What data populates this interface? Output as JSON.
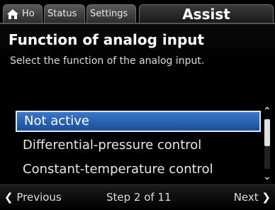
{
  "tabs": {
    "home_label": "Ho",
    "status_label": "Status",
    "settings_label": "Settings",
    "assist_label": "Assist"
  },
  "page": {
    "title": "Function of analog input",
    "subtitle": "Select the function of the analog input."
  },
  "list": {
    "items": [
      {
        "label": "Not active",
        "selected": true
      },
      {
        "label": "Differential-pressure control",
        "selected": false
      },
      {
        "label": "Constant-temperature control",
        "selected": false
      }
    ]
  },
  "footer": {
    "previous_label": "Previous",
    "step_text": "Step 2 of 11",
    "next_label": "Next"
  },
  "colors": {
    "selection": "#2a63b5",
    "background": "#000000"
  },
  "icons": {
    "home": "home-icon",
    "prev": "chevron-left-icon",
    "next": "chevron-right-icon",
    "scroll_up": "chevron-up-icon",
    "scroll_down": "chevron-down-icon"
  }
}
